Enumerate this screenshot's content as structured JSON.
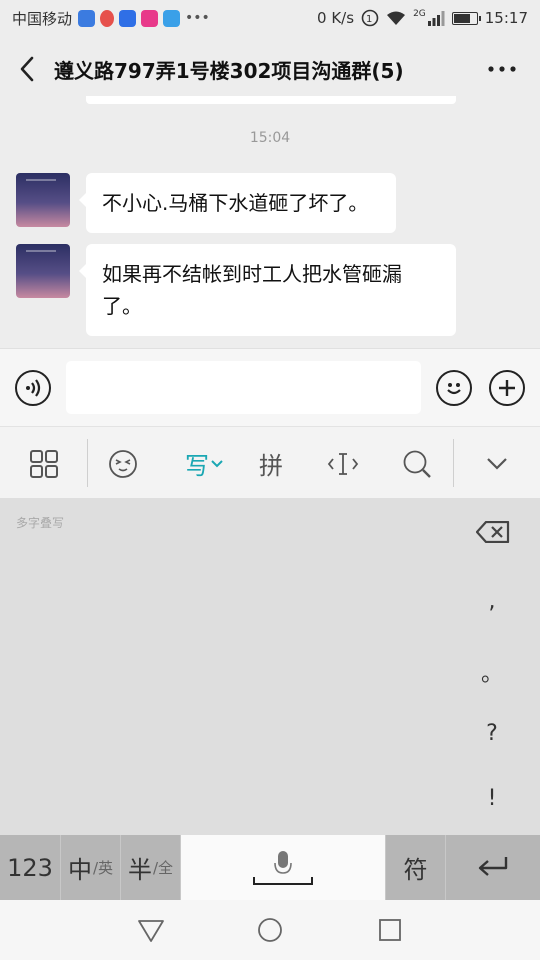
{
  "status_bar": {
    "carrier": "中国移动",
    "speed": "0 K/s",
    "network": "2G",
    "time": "15:17",
    "battery_level": 0.75
  },
  "header": {
    "title": "遵义路797弄1号楼302项目沟通群(5)",
    "back_icon": "chevron-left-icon",
    "more_icon": "more-dots-icon"
  },
  "chat": {
    "timestamp": "15:04",
    "messages": [
      {
        "text": "不小心.马桶下水道砸了坏了。"
      },
      {
        "text": "如果再不结帐到时工人把水管砸漏了。"
      }
    ]
  },
  "input_bar": {
    "voice_icon": "voice-icon",
    "emoji_icon": "emoji-icon",
    "plus_icon": "plus-icon"
  },
  "ime_toolbar": {
    "items": [
      {
        "icon": "grid-icon"
      },
      {
        "icon": "ime-emoji-icon"
      },
      {
        "label": "写",
        "icon": "chevron-down-icon",
        "active": true
      },
      {
        "label": "拼"
      },
      {
        "icon": "cursor-icon"
      },
      {
        "icon": "search-icon"
      },
      {
        "icon": "collapse-icon"
      }
    ],
    "active_color": "#1aa7b3"
  },
  "handwriting": {
    "hint": "多字叠写",
    "delete_icon": "backspace-icon",
    "punctuation": [
      ",",
      "。",
      "?",
      "!"
    ]
  },
  "keyboard_row": {
    "num_key": "123",
    "lang_key": "中",
    "lang_key_sub": "/英",
    "width_key": "半",
    "width_key_sub": "/全",
    "space_icon": "microphone-icon",
    "symbol_key": "符",
    "enter_icon": "enter-icon"
  },
  "nav_bar": {
    "back_icon": "triangle-back-icon",
    "home_icon": "circle-home-icon",
    "recent_icon": "square-recent-icon"
  }
}
